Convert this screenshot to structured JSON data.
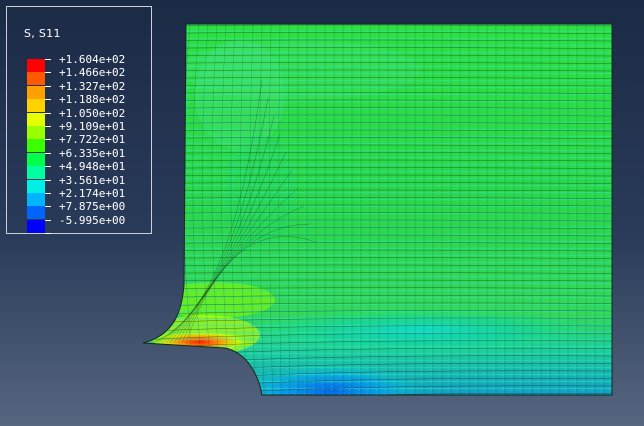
{
  "legend": {
    "title": "S, S11",
    "levels": [
      {
        "label": "+1.604e+02",
        "color": "#ff0000"
      },
      {
        "label": "+1.466e+02",
        "color": "#ff5a00"
      },
      {
        "label": "+1.327e+02",
        "color": "#ffa000"
      },
      {
        "label": "+1.188e+02",
        "color": "#ffd200"
      },
      {
        "label": "+1.050e+02",
        "color": "#e6ff00"
      },
      {
        "label": "+9.109e+01",
        "color": "#9aff00"
      },
      {
        "label": "+7.722e+01",
        "color": "#3cff00"
      },
      {
        "label": "+6.335e+01",
        "color": "#00ff4a"
      },
      {
        "label": "+4.948e+01",
        "color": "#00ffa0"
      },
      {
        "label": "+3.561e+01",
        "color": "#00f0e6"
      },
      {
        "label": "+2.174e+01",
        "color": "#00b4ff"
      },
      {
        "label": "+7.875e+00",
        "color": "#0064ff"
      },
      {
        "label": "-5.995e+00",
        "color": "#0000ff"
      }
    ]
  },
  "colors": {
    "mesh_base": "#2edc3a",
    "arrow": "#3fe0d0",
    "mesh_line": "#0a1a10",
    "hot": "#ff2000",
    "cool": "#0080ff"
  }
}
